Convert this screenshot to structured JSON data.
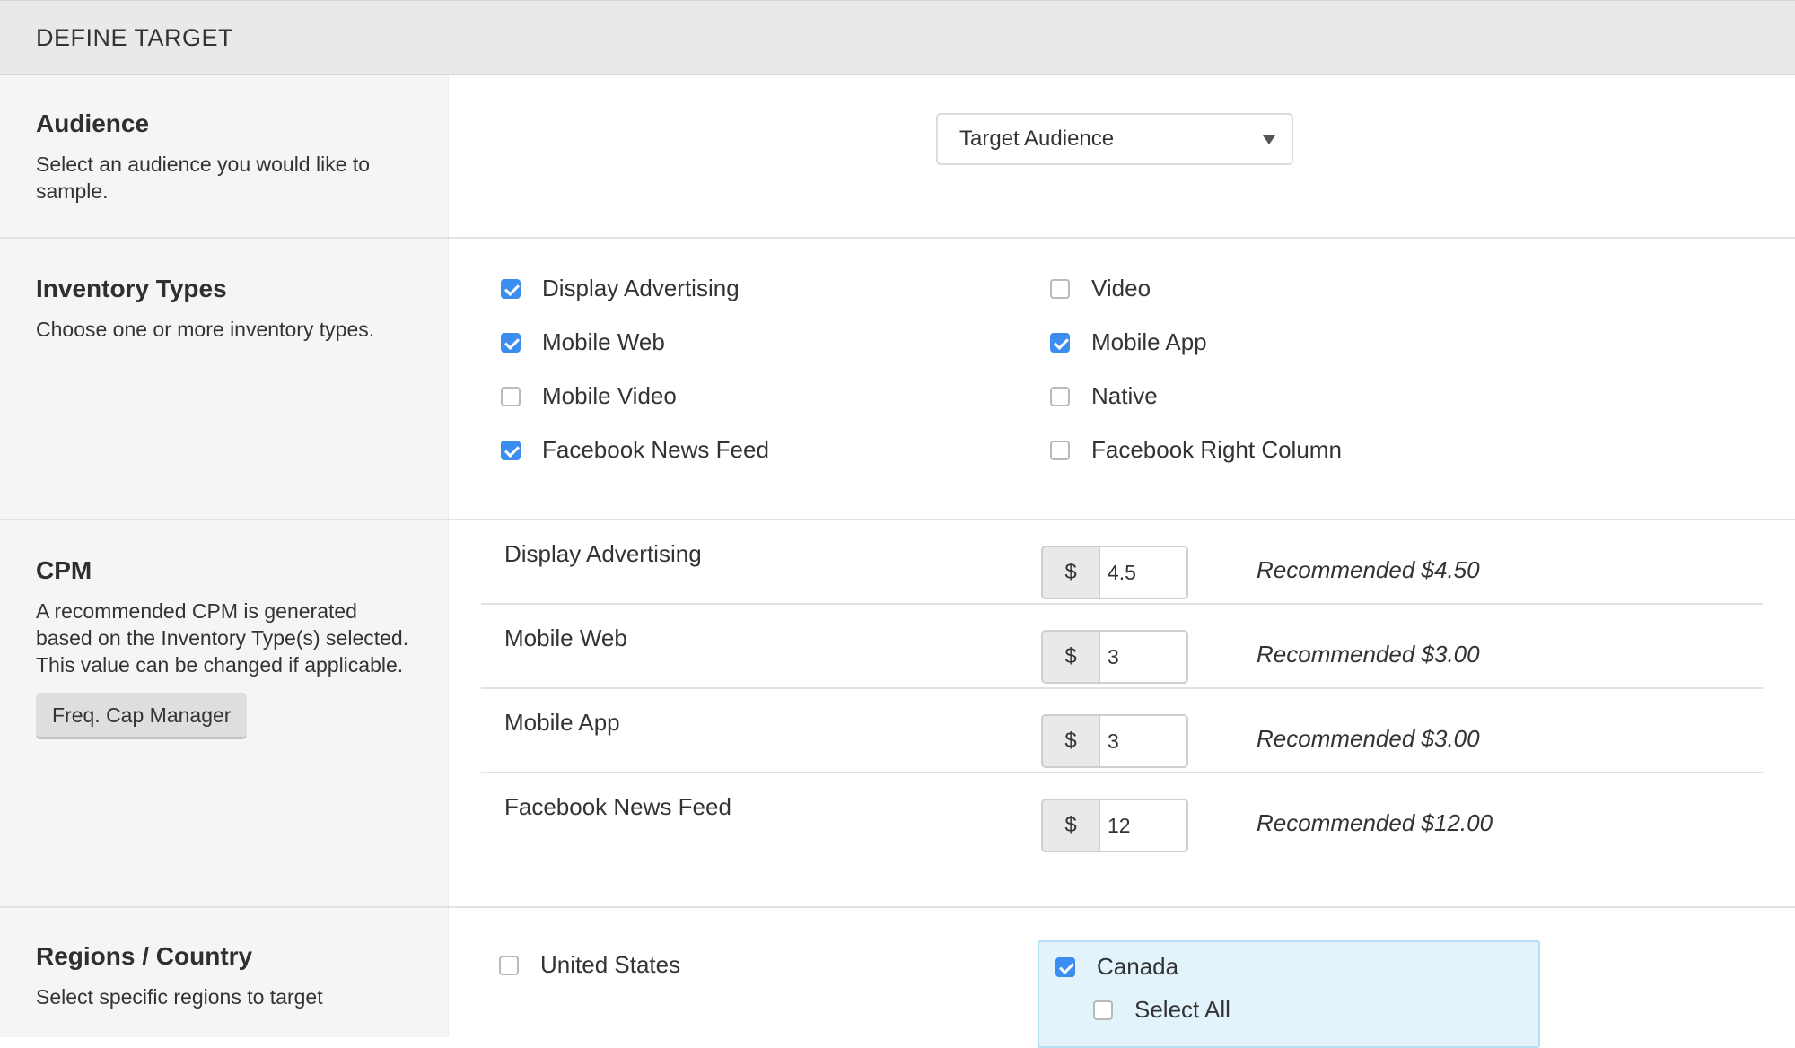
{
  "header": {
    "title": "DEFINE TARGET"
  },
  "audience": {
    "title": "Audience",
    "description": "Select an audience you would like to sample.",
    "select_value": "Target Audience"
  },
  "inventory": {
    "title": "Inventory Types",
    "description": "Choose one or more inventory types.",
    "items": [
      {
        "label": "Display Advertising",
        "checked": true
      },
      {
        "label": "Video",
        "checked": false
      },
      {
        "label": "Mobile Web",
        "checked": true
      },
      {
        "label": "Mobile App",
        "checked": true
      },
      {
        "label": "Mobile Video",
        "checked": false
      },
      {
        "label": "Native",
        "checked": false
      },
      {
        "label": "Facebook News Feed",
        "checked": true
      },
      {
        "label": "Facebook Right Column",
        "checked": false
      }
    ]
  },
  "cpm": {
    "title": "CPM",
    "description": "A recommended CPM is generated based on the Inventory Type(s) selected. This value can be changed if applicable.",
    "freq_button": "Freq. Cap Manager",
    "currency_symbol": "$",
    "rows": [
      {
        "label": "Display Advertising",
        "value": "4.5",
        "recommended": "Recommended $4.50"
      },
      {
        "label": "Mobile Web",
        "value": "3",
        "recommended": "Recommended $3.00"
      },
      {
        "label": "Mobile App",
        "value": "3",
        "recommended": "Recommended $3.00"
      },
      {
        "label": "Facebook News Feed",
        "value": "12",
        "recommended": "Recommended $12.00"
      }
    ]
  },
  "regions": {
    "title": "Regions / Country",
    "description": "Select specific regions to target",
    "united_states": {
      "label": "United States",
      "checked": false
    },
    "canada": {
      "label": "Canada",
      "checked": true
    },
    "select_all": {
      "label": "Select All",
      "checked": false
    }
  },
  "colors": {
    "accent": "#3b8df0",
    "panel_bg": "#f5f5f5",
    "header_bg": "#e9e9e9",
    "canada_box_bg": "#e3f3fb"
  }
}
